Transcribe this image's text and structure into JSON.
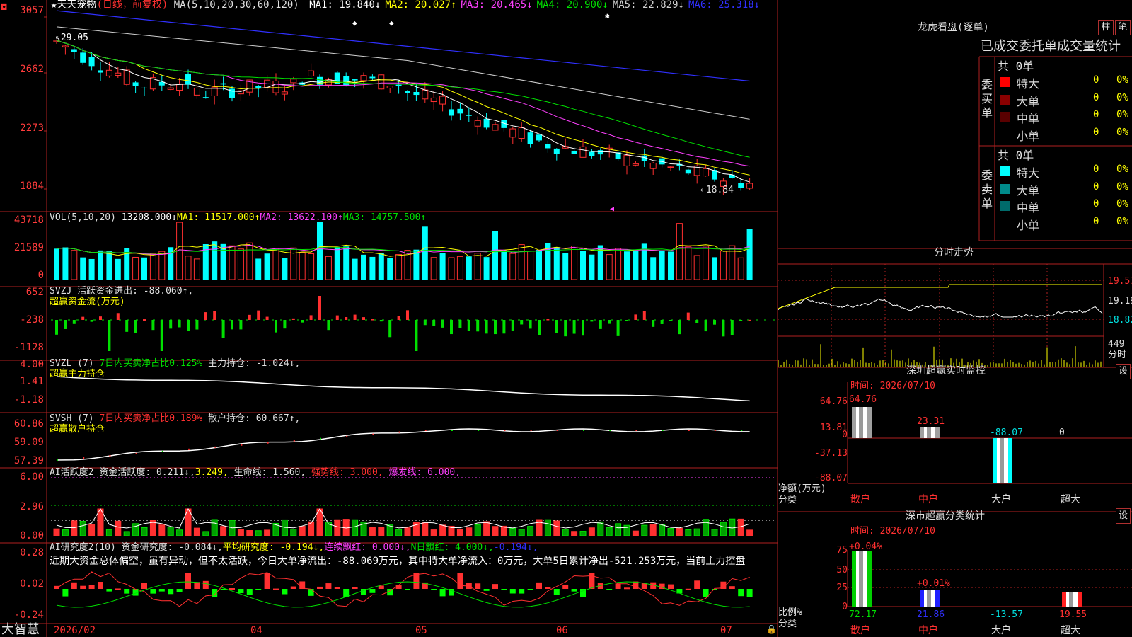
{
  "app": {
    "brand": "大智慧",
    "stock": "天天宠物",
    "mode": "(日线，前复权)"
  },
  "main": {
    "ma_prefix": "MA(5,10,20,30,60,120)",
    "ma_items": [
      {
        "label": "MA1:",
        "value": "19.840",
        "dir": "↓",
        "color": "#ffffff"
      },
      {
        "label": "MA2:",
        "value": "20.027",
        "dir": "↑",
        "color": "#ffff00"
      },
      {
        "label": "MA3:",
        "value": "20.465",
        "dir": "↓",
        "color": "#ff40ff"
      },
      {
        "label": "MA4:",
        "value": "20.900",
        "dir": "↓",
        "color": "#00e000"
      },
      {
        "label": "MA5:",
        "value": "22.829",
        "dir": "↓",
        "color": "#d0d0d0"
      },
      {
        "label": "MA6:",
        "value": "25.318",
        "dir": "↓",
        "color": "#3030ff"
      }
    ],
    "y_ticks": [
      "3057",
      "2662",
      "2273",
      "1884"
    ],
    "high_label": "29.05",
    "low_label": "←18.84"
  },
  "vol": {
    "header": "VOL(5,10,20)",
    "value": "13208.000↓",
    "ma1": "MA1: 11517.000↑",
    "ma2": "MA2: 13622.100↑",
    "ma3": "MA3: 14757.500↑",
    "y_ticks": [
      "43718",
      "21589",
      "0"
    ]
  },
  "svzj": {
    "header": "SVZJ",
    "text": "活跃资金进出: -88.060↑,",
    "sub": "超赢资金流(万元)",
    "y_ticks": [
      "652",
      "-238",
      "-1128"
    ]
  },
  "svzl": {
    "header": "SVZL (7)",
    "ratio": "7日内买卖净占比0.125%",
    "hold": "主力持仓: -1.024↓,",
    "sub": "超赢主力持仓",
    "y_ticks": [
      "4.00",
      "1.41",
      "-1.18"
    ]
  },
  "svsh": {
    "header": "SVSH (7)",
    "ratio": "7日内买卖净占比0.189%",
    "hold": "散户持仓: 60.667↑,",
    "sub": "超赢散户持仓",
    "y_ticks": [
      "60.86",
      "59.09",
      "57.39"
    ]
  },
  "ai1": {
    "header": "AI活跃度2",
    "t1": "资金活跃度: 0.211↓,",
    "t2": "3.249,",
    "t3": "生命线: 1.560,",
    "t4": "强势线: 3.000,",
    "t5": "爆发线: 6.000,",
    "y_ticks": [
      "6.00",
      "2.96",
      "0.00"
    ]
  },
  "ai2": {
    "header": "AI研究度2(10)",
    "t1": "资金研究度: -0.084↓,",
    "t2": "平均研究度: -0.194↓,",
    "t3": "连续飘红: 0.000↓,",
    "t4": "N日飘红: 4.000↓,",
    "t5": "-0.194↓,",
    "comment": "近期大资金总体偏空，虽有异动，但不太活跃，今日大单净流出：-88.069万元，其中特大单净流入：0万元，大单5日累计净出-521.253万元，当前主力控盘",
    "y_ticks": [
      "0.28",
      "0.02",
      "-0.24"
    ]
  },
  "x_labels": [
    "2026/02",
    "04",
    "05",
    "06",
    "07"
  ],
  "sidebar": {
    "title": "龙虎看盘(逐单)",
    "btn_bar": "柱",
    "btn_pen": "笔",
    "tabs_line": "已成交委托单成交量统计",
    "buy": {
      "label": "委买单",
      "total": "共 0单",
      "rows": [
        {
          "name": "特大",
          "val": "0",
          "pct": "0%",
          "color": "#ff0000"
        },
        {
          "name": "大单",
          "val": "0",
          "pct": "0%",
          "color": "#8b0000"
        },
        {
          "name": "中单",
          "val": "0",
          "pct": "0%",
          "color": "#5a0000"
        },
        {
          "name": "小单",
          "val": "0",
          "pct": "0%",
          "color": ""
        }
      ]
    },
    "sell": {
      "label": "委卖单",
      "total": "共 0单",
      "rows": [
        {
          "name": "特大",
          "val": "0",
          "pct": "0%",
          "color": "#00ffff"
        },
        {
          "name": "大单",
          "val": "0",
          "pct": "0%",
          "color": "#008b8b"
        },
        {
          "name": "中单",
          "val": "0",
          "pct": "0%",
          "color": "#006b6b"
        },
        {
          "name": "小单",
          "val": "0",
          "pct": "0%",
          "color": ""
        }
      ]
    },
    "intraday": {
      "title": "分时走势",
      "p1": "19.57",
      "p2": "19.19",
      "p3": "18.82",
      "vol": "449",
      "unit": "分时"
    },
    "monitor": {
      "title": "深圳超赢实时监控",
      "btn": "设",
      "time": "时间: 2026/07/10",
      "y_ticks": [
        "64.76",
        "13.81",
        "0",
        "-37.13",
        "-88.07"
      ],
      "ylabel": "净额(万元)",
      "xlabel": "分类",
      "cats": [
        "散户",
        "中户",
        "大户",
        "超大"
      ],
      "vals": [
        "64.76",
        "23.31",
        "-88.07",
        "0"
      ]
    },
    "stats": {
      "title": "深市超赢分类统计",
      "btn": "设",
      "time": "时间: 2026/07/10",
      "y_ticks": [
        "75",
        "50",
        "25",
        "0"
      ],
      "ylabel": "比例%",
      "xlabel": "分类",
      "cats": [
        "散户",
        "中户",
        "大户",
        "超大"
      ],
      "top": [
        "+0.04%",
        "+0.01%"
      ],
      "bottom": [
        "72.17",
        "21.86",
        "-13.57",
        "19.55"
      ]
    }
  }
}
